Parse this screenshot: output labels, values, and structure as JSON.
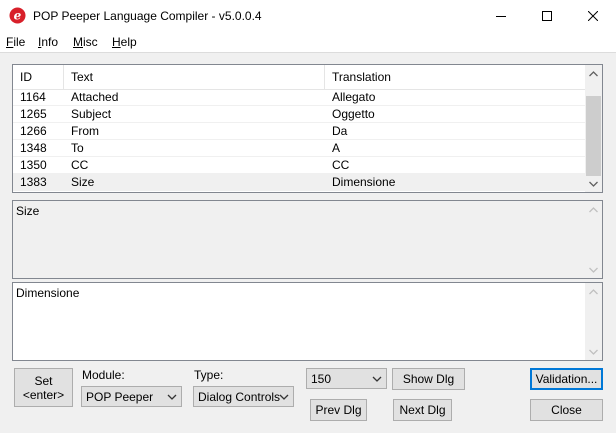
{
  "window": {
    "title": "POP Peeper Language Compiler - v5.0.0.4",
    "icon": "pop-peeper-e-icon"
  },
  "menu": {
    "items": [
      {
        "first": "F",
        "rest": "ile"
      },
      {
        "first": "I",
        "rest": "nfo"
      },
      {
        "first": "M",
        "rest": "isc"
      },
      {
        "first": "H",
        "rest": "elp"
      }
    ]
  },
  "list": {
    "columns": [
      "ID",
      "Text",
      "Translation"
    ],
    "rows": [
      {
        "id": "1164",
        "text": "Attached",
        "translation": "Allegato"
      },
      {
        "id": "1265",
        "text": "Subject",
        "translation": "Oggetto"
      },
      {
        "id": "1266",
        "text": "From",
        "translation": "Da"
      },
      {
        "id": "1348",
        "text": "To",
        "translation": "A"
      },
      {
        "id": "1350",
        "text": "CC",
        "translation": "CC"
      },
      {
        "id": "1383",
        "text": "Size",
        "translation": "Dimensione"
      }
    ],
    "selected_index": 5
  },
  "source_text": "Size",
  "translation_text": "Dimensione",
  "controls": {
    "set_button": "Set\n<enter>",
    "module_label": "Module:",
    "module_value": "POP Peeper",
    "type_label": "Type:",
    "type_value": "Dialog Controls",
    "dialog_number": "150",
    "show_dlg": "Show Dlg",
    "prev_dlg": "Prev Dlg",
    "next_dlg": "Next Dlg",
    "validation": "Validation...",
    "close": "Close"
  },
  "colors": {
    "icon_red": "#d8202a",
    "accent": "#0078d7"
  }
}
